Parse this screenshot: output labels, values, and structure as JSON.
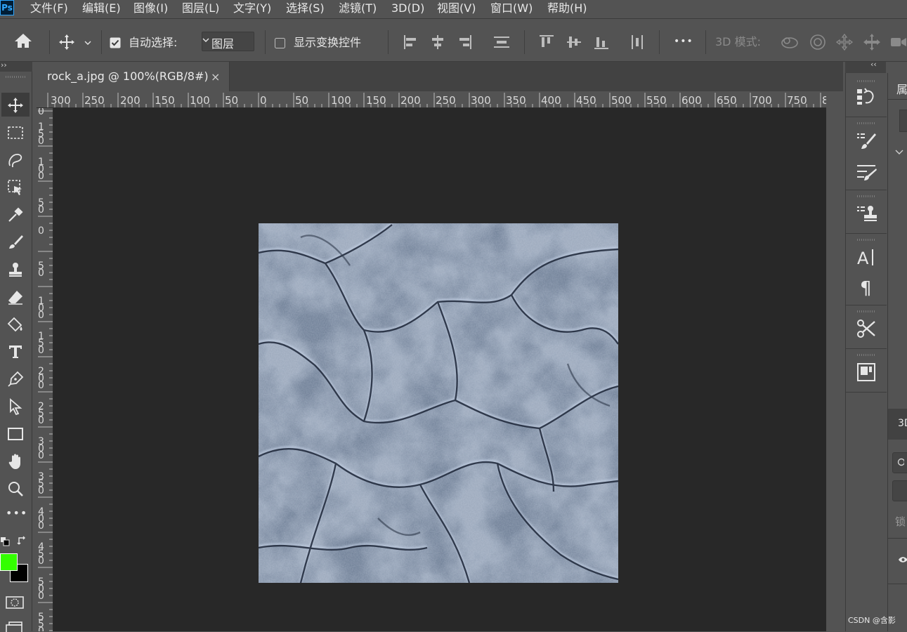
{
  "app": {
    "logo": "Ps"
  },
  "menu": [
    {
      "label": "文件(F)"
    },
    {
      "label": "编辑(E)"
    },
    {
      "label": "图像(I)"
    },
    {
      "label": "图层(L)"
    },
    {
      "label": "文字(Y)"
    },
    {
      "label": "选择(S)"
    },
    {
      "label": "滤镜(T)"
    },
    {
      "label": "3D(D)"
    },
    {
      "label": "视图(V)"
    },
    {
      "label": "窗口(W)"
    },
    {
      "label": "帮助(H)"
    }
  ],
  "options": {
    "auto_select_label": "自动选择:",
    "auto_select_checked": true,
    "auto_select_value": "图层",
    "show_transform_label": "显示变换控件",
    "show_transform_checked": false,
    "more_label": "•••",
    "mode_3d_label": "3D 模式:"
  },
  "document": {
    "tab_title": "rock_a.jpg @ 100%(RGB/8#)",
    "close_label": "×"
  },
  "rulers": {
    "horizontal": [
      "300",
      "250",
      "200",
      "150",
      "100",
      "50",
      "0",
      "50",
      "100",
      "150",
      "200",
      "250",
      "300",
      "350",
      "400",
      "450",
      "500",
      "550",
      "600",
      "650",
      "700",
      "750",
      "8"
    ],
    "vertical": [
      "0",
      "150",
      "100",
      "50",
      "0",
      "50",
      "100",
      "150",
      "200",
      "250",
      "300",
      "350",
      "400",
      "450",
      "500",
      "550"
    ]
  },
  "toolbar": {
    "collapse_label": "››",
    "more_tools_label": "•••",
    "foreground_color": "#33ff00",
    "background_color": "#000000"
  },
  "dock": {
    "collapse_label": "‹‹"
  },
  "panels": {
    "properties_title_partial": "属",
    "panel_3d_partial": "3D",
    "lock_partial": "锁"
  },
  "watermark": "CSDN @含影",
  "colors": {
    "ui_bg": "#535353",
    "canvas_bg": "#282828",
    "ps_blue": "#31a8ff"
  }
}
